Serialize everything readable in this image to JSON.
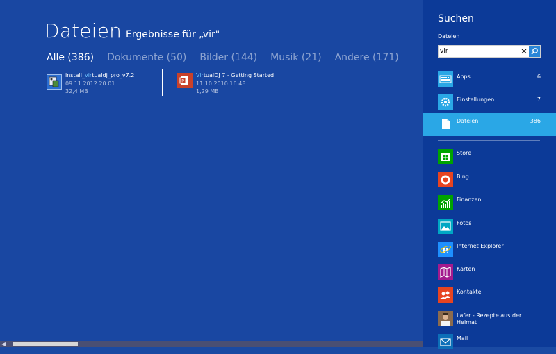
{
  "main": {
    "title": "Dateien",
    "subtitle": "Ergebnisse für „vir\"",
    "filters": [
      {
        "label": "Alle (386)",
        "active": true
      },
      {
        "label": "Dokumente (50)",
        "active": false
      },
      {
        "label": "Bilder (144)",
        "active": false
      },
      {
        "label": "Musik (21)",
        "active": false
      },
      {
        "label": "Andere (171)",
        "active": false
      }
    ],
    "results": [
      {
        "name_prefix": "install_",
        "name_match": "vir",
        "name_suffix": "tualdj_pro_v7.2",
        "date": "09.11.2012 20:01",
        "size": "32,4 MB",
        "icon": "installer-icon"
      },
      {
        "name_prefix": "",
        "name_match": "Vir",
        "name_suffix": "tualDJ 7 - Getting Started",
        "date": "11.10.2010 16:48",
        "size": "1,29 MB",
        "icon": "pdf-document-icon"
      }
    ]
  },
  "pane": {
    "title": "Suchen",
    "scope": "Dateien",
    "search_value": "vir",
    "categories": [
      {
        "label": "Apps",
        "count": "6",
        "icon": "keyboard-icon"
      },
      {
        "label": "Einstellungen",
        "count": "7",
        "icon": "gear-icon"
      },
      {
        "label": "Dateien",
        "count": "386",
        "icon": "file-icon",
        "selected": true
      }
    ],
    "apps": [
      {
        "label": "Store",
        "icon": "store-icon"
      },
      {
        "label": "Bing",
        "icon": "bing-icon"
      },
      {
        "label": "Finanzen",
        "icon": "finance-icon"
      },
      {
        "label": "Fotos",
        "icon": "photos-icon"
      },
      {
        "label": "Internet Explorer",
        "icon": "internet-explorer-icon"
      },
      {
        "label": "Karten",
        "icon": "maps-icon"
      },
      {
        "label": "Kontakte",
        "icon": "contacts-icon"
      },
      {
        "label": "Lafer - Rezepte aus der Heimat",
        "icon": "lafer-app-icon"
      },
      {
        "label": "Mail",
        "icon": "mail-icon"
      }
    ]
  },
  "colors": {
    "main_bg": "#1947a2",
    "pane_bg": "#0c3a98",
    "selected_bg": "#2aa7e6",
    "match_highlight": "#6ec3ff"
  },
  "scroll_fraction_visible": 0.16
}
